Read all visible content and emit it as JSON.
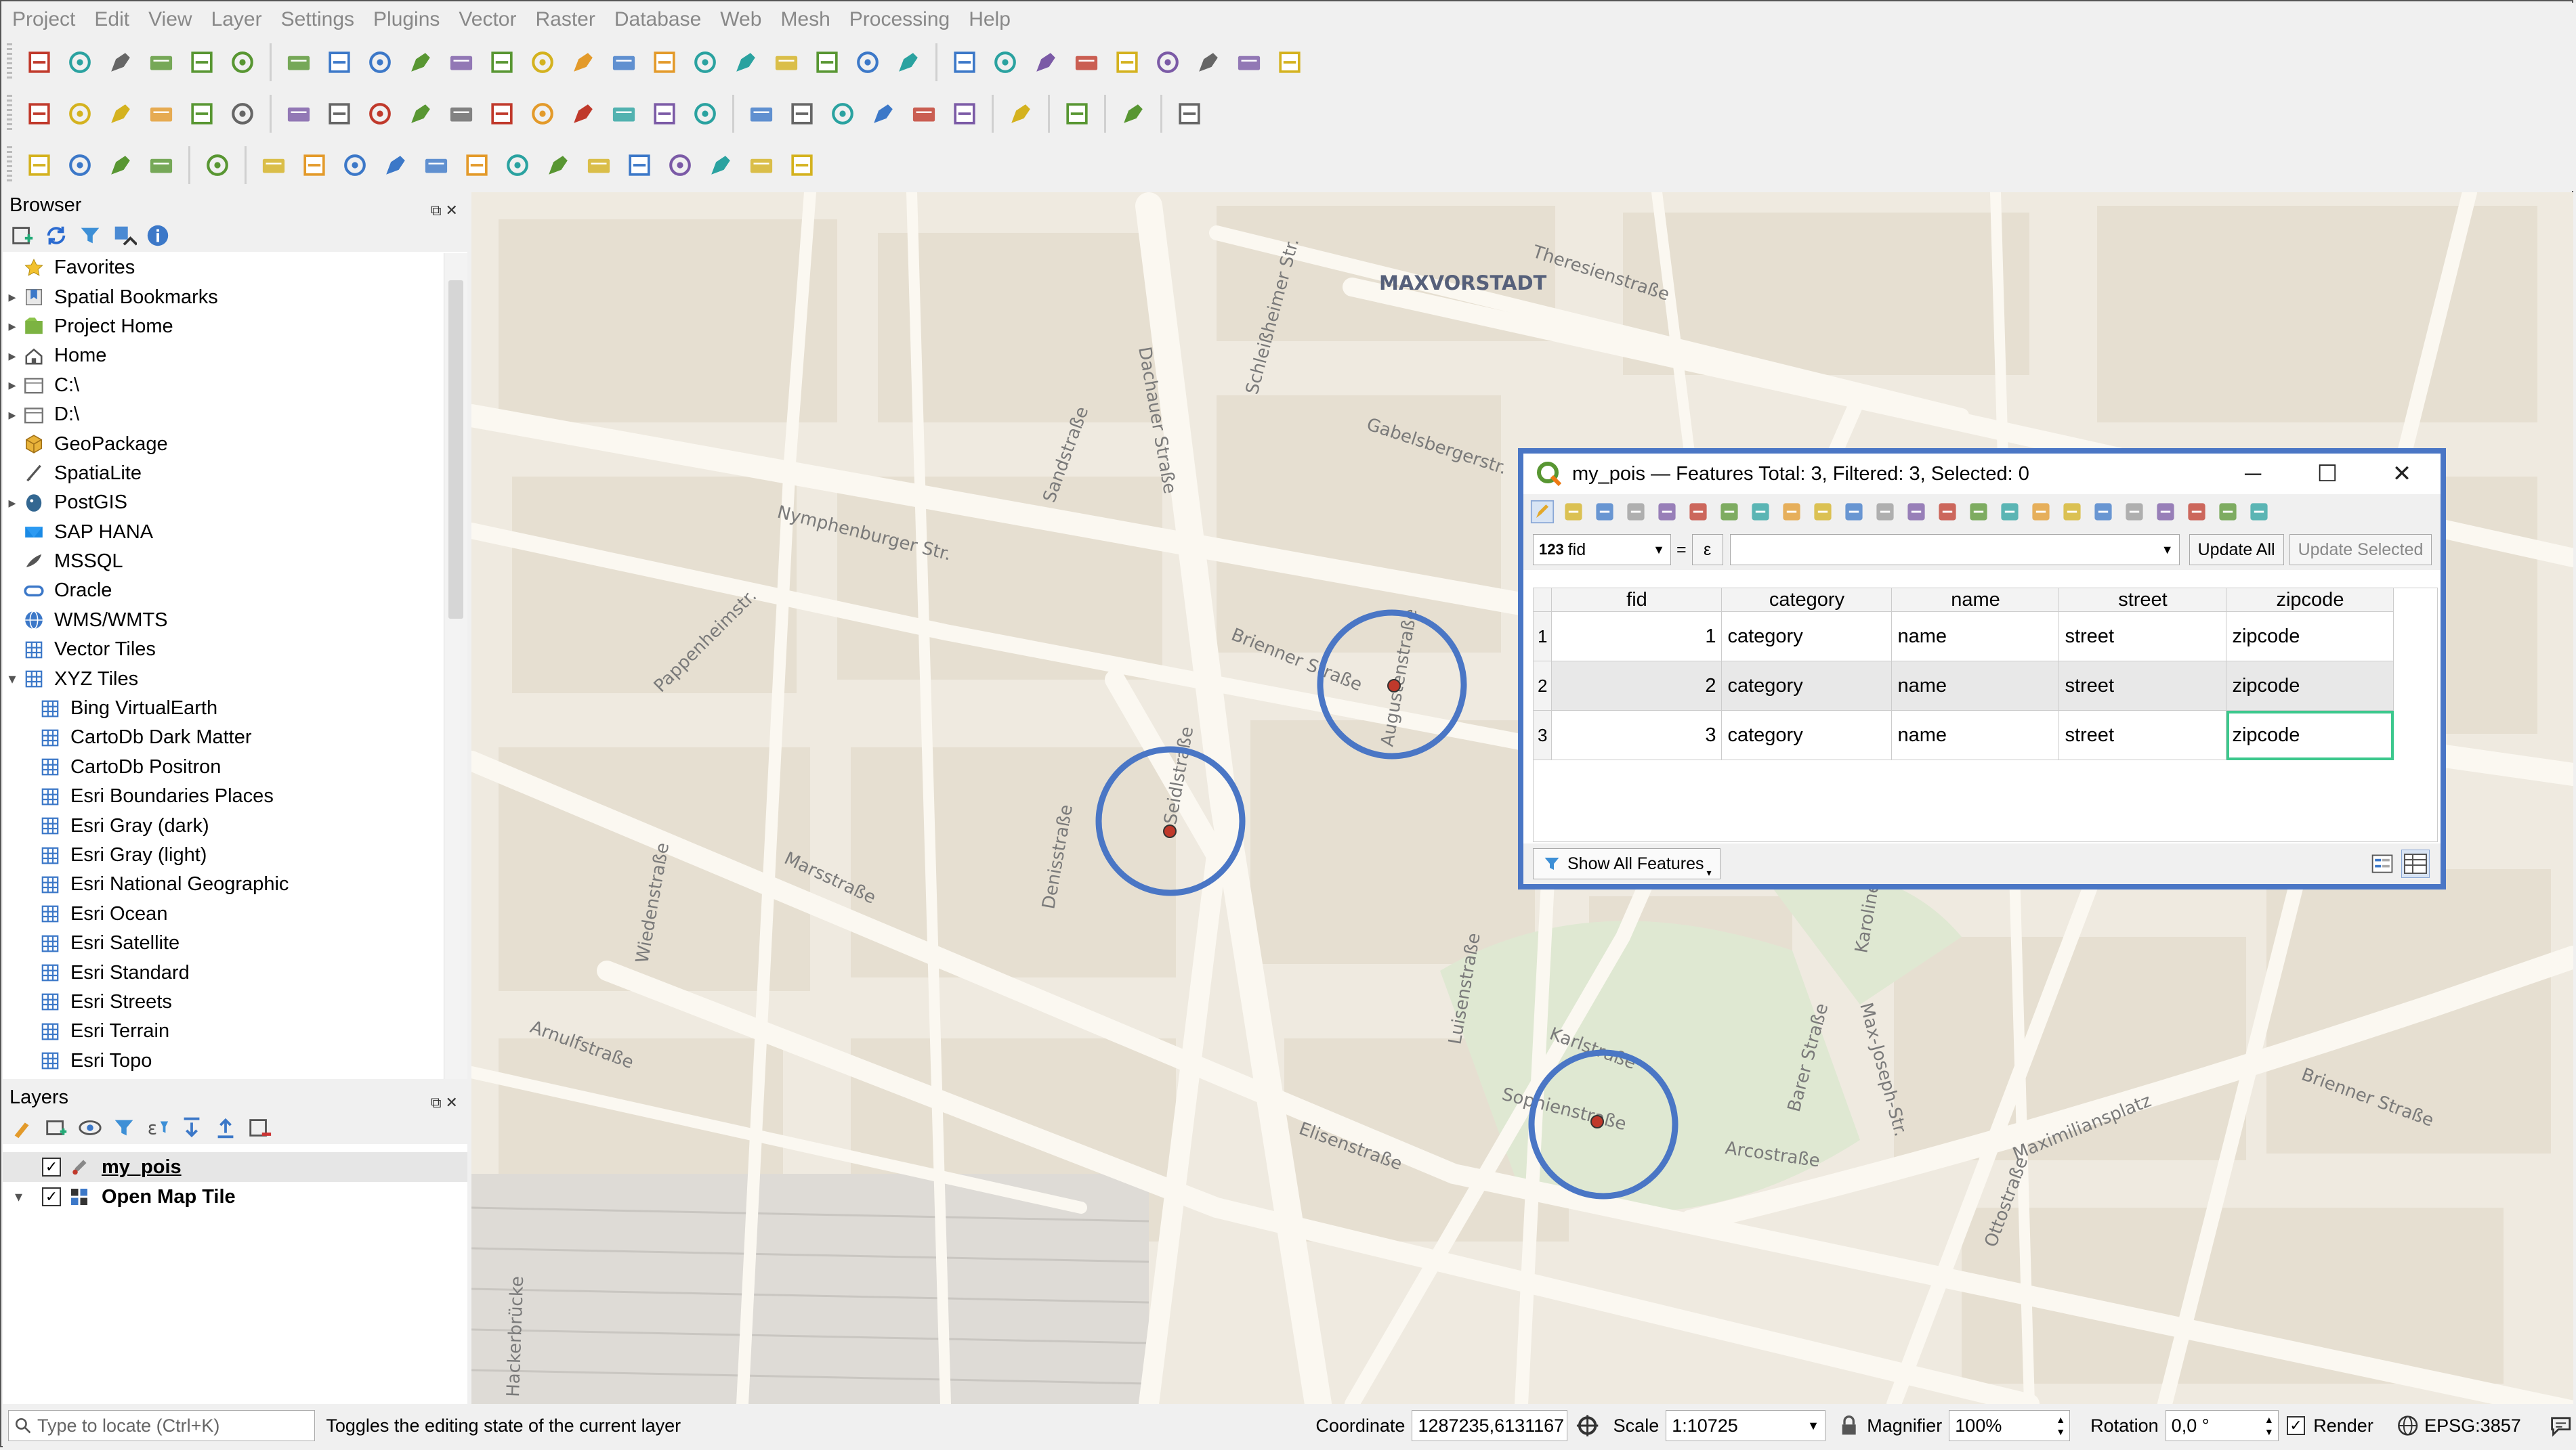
{
  "menu": [
    "Project",
    "Edit",
    "View",
    "Layer",
    "Settings",
    "Plugins",
    "Vector",
    "Raster",
    "Database",
    "Web",
    "Mesh",
    "Processing",
    "Help"
  ],
  "browser": {
    "title": "Browser",
    "items": [
      {
        "label": "Favorites",
        "icon": "star-icon",
        "arrow": ""
      },
      {
        "label": "Spatial Bookmarks",
        "icon": "bookmark-icon",
        "arrow": "▸"
      },
      {
        "label": "Project Home",
        "icon": "project-home-icon",
        "arrow": "▸"
      },
      {
        "label": "Home",
        "icon": "home-icon",
        "arrow": "▸"
      },
      {
        "label": "C:\\",
        "icon": "drive-icon",
        "arrow": "▸"
      },
      {
        "label": "D:\\",
        "icon": "drive-icon",
        "arrow": "▸"
      },
      {
        "label": "GeoPackage",
        "icon": "geopackage-icon",
        "arrow": ""
      },
      {
        "label": "SpatiaLite",
        "icon": "spatialite-icon",
        "arrow": ""
      },
      {
        "label": "PostGIS",
        "icon": "postgis-icon",
        "arrow": "▸"
      },
      {
        "label": "SAP HANA",
        "icon": "saphana-icon",
        "arrow": ""
      },
      {
        "label": "MSSQL",
        "icon": "mssql-icon",
        "arrow": ""
      },
      {
        "label": "Oracle",
        "icon": "oracle-icon",
        "arrow": ""
      },
      {
        "label": "WMS/WMTS",
        "icon": "globe-icon",
        "arrow": ""
      },
      {
        "label": "Vector Tiles",
        "icon": "grid-icon",
        "arrow": ""
      },
      {
        "label": "XYZ Tiles",
        "icon": "grid-icon",
        "arrow": "▾"
      }
    ],
    "xyz_children": [
      "Bing VirtualEarth",
      "CartoDb Dark Matter",
      "CartoDb Positron",
      "Esri Boundaries Places",
      "Esri Gray (dark)",
      "Esri Gray (light)",
      "Esri National Geographic",
      "Esri Ocean",
      "Esri Satellite",
      "Esri Standard",
      "Esri Streets",
      "Esri Terrain",
      "Esri Topo"
    ]
  },
  "layers": {
    "title": "Layers",
    "items": [
      {
        "label": "my_pois",
        "checked": "✓"
      },
      {
        "label": "Open Map Tile",
        "checked": "✓"
      }
    ]
  },
  "map": {
    "district_label": "MAXVORSTADT",
    "streets": [
      "Theresienstraße",
      "Gabelsbergerstr.",
      "Nymphenburger Str.",
      "Brienner Straße",
      "Marsstraße",
      "Arnulfstraße",
      "Elisenstraße",
      "Maximiliansplatz",
      "Dachauer Straße",
      "Seidlstraße",
      "Karlstraße",
      "Augustenstraße",
      "Sophienstraße",
      "Arcostraße",
      "Karolinenplatz",
      "Brienner Straße",
      "Hackerbrücke",
      "Schleißheimer Str.",
      "Sandstraße",
      "Pappenheimstr.",
      "Wiedenstraße",
      "Denisstraße",
      "Luisenstraße",
      "Ottostraße",
      "Barer Straße",
      "Max-Joseph-Str."
    ]
  },
  "attr_table": {
    "title": "my_pois — Features Total: 3, Filtered: 3, Selected: 0",
    "field_combo": "fid",
    "field_combo_prefix": "123",
    "equals": "=",
    "epsilon": "ε",
    "update_all": "Update All",
    "update_selected": "Update Selected",
    "columns": [
      "fid",
      "category",
      "name",
      "street",
      "zipcode"
    ],
    "rows": [
      {
        "n": "1",
        "fid": "1",
        "category": "category",
        "name": "name",
        "street": "street",
        "zipcode": "zipcode"
      },
      {
        "n": "2",
        "fid": "2",
        "category": "category",
        "name": "name",
        "street": "street",
        "zipcode": "zipcode"
      },
      {
        "n": "3",
        "fid": "3",
        "category": "category",
        "name": "name",
        "street": "street",
        "zipcode": "zipcode"
      }
    ],
    "show_all": "Show All Features",
    "colors": {
      "border": "#4a76c5",
      "selected_cell": "#3cc88d"
    }
  },
  "status": {
    "locate_placeholder": "Type to locate (Ctrl+K)",
    "message": "Toggles the editing state of the current layer",
    "coordinate_label": "Coordinate",
    "coordinate": "1287235,6131167",
    "scale_label": "Scale",
    "scale": "1:10725",
    "magnifier_label": "Magnifier",
    "magnifier": "100%",
    "rotation_label": "Rotation",
    "rotation": "0,0 °",
    "render_label": "Render",
    "crs": "EPSG:3857"
  },
  "colors": {
    "map_bg": "#efeae0",
    "road": "#fbf8f1",
    "marker": "#c0392b",
    "highlight_circle": "#4a76c5"
  }
}
